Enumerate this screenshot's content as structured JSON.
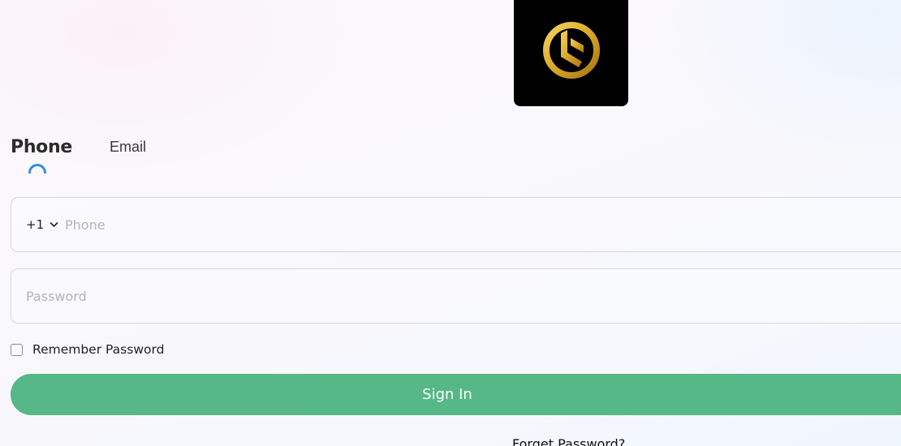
{
  "tabs": {
    "phone_label": "Phone",
    "email_label": "Email",
    "active": "phone"
  },
  "phone_field": {
    "country_code": "+1",
    "placeholder": "Phone",
    "value": ""
  },
  "password_field": {
    "placeholder": "Password",
    "value": ""
  },
  "remember": {
    "label": "Remember Password",
    "checked": false
  },
  "signin": {
    "label": "Sign In"
  },
  "forget": {
    "label": "Forget Password?"
  },
  "colors": {
    "primary": "#55b886",
    "tab_indicator": "#2f8fe8",
    "logo_bg": "#000000",
    "logo_gold": "#d4a82a"
  },
  "icons": {
    "logo": "gold-circle-brand-logo",
    "country_dropdown": "chevron-down-icon"
  }
}
